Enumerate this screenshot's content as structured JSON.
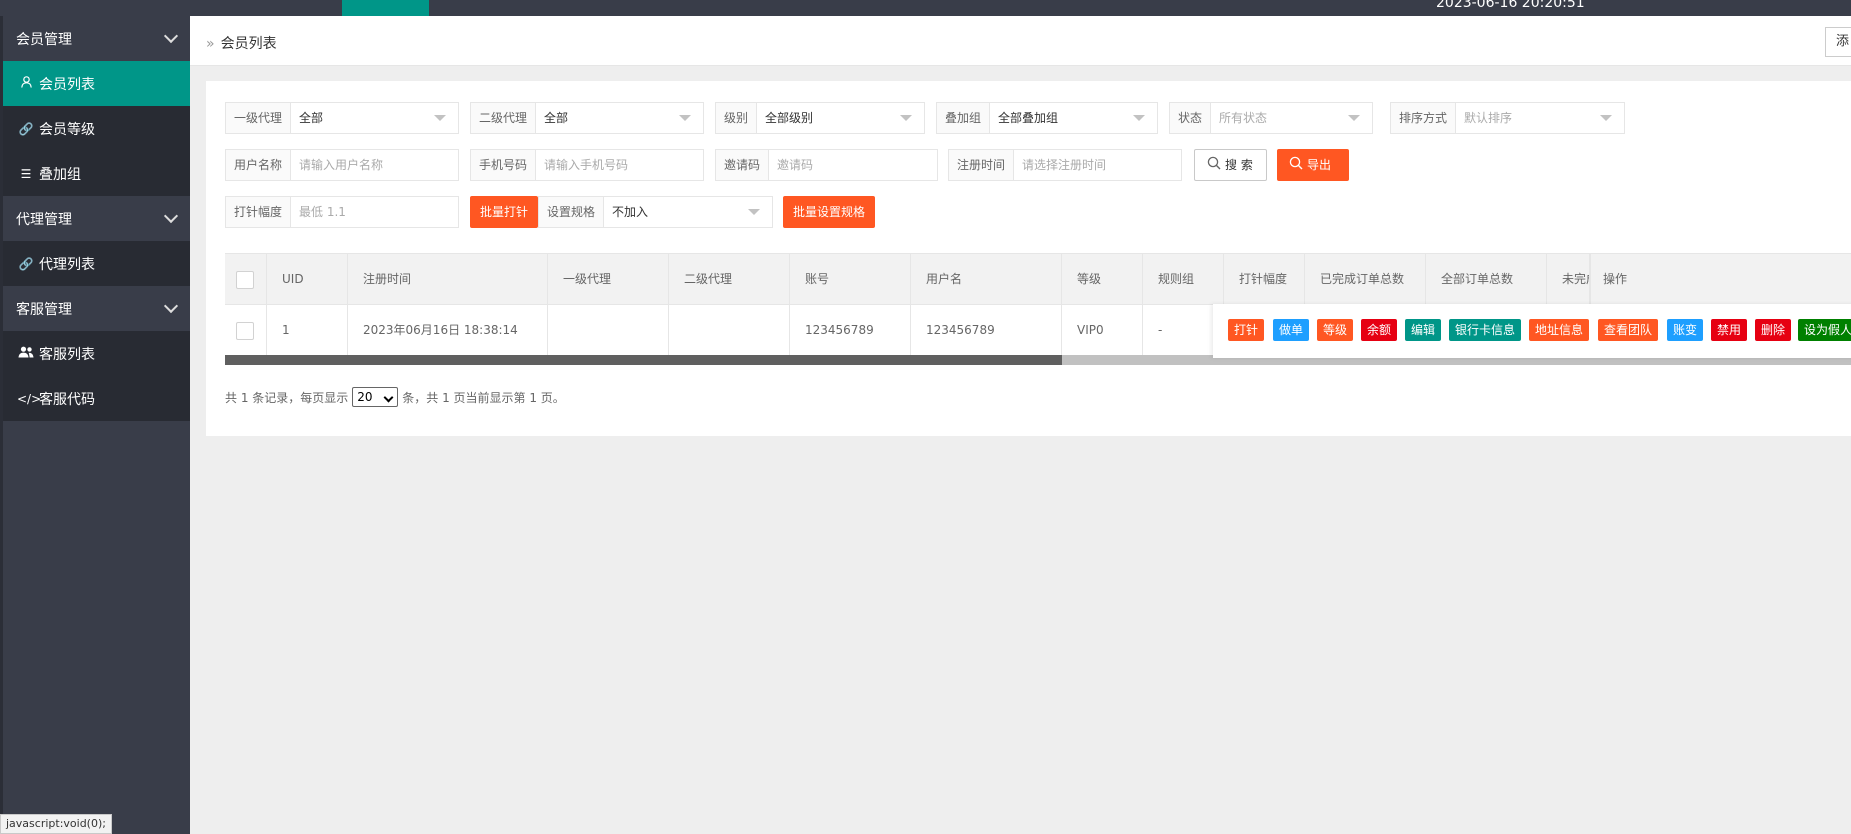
{
  "topbar": {
    "datetime": "2023-06-16 20:20:51"
  },
  "sidebar": {
    "groups": [
      {
        "title": "会员管理",
        "items": [
          {
            "label": "会员列表",
            "icon": "user-icon",
            "active": true
          },
          {
            "label": "会员等级",
            "icon": "link-icon"
          },
          {
            "label": "叠加组",
            "icon": "list-icon"
          }
        ]
      },
      {
        "title": "代理管理",
        "items": [
          {
            "label": "代理列表",
            "icon": "link-icon"
          }
        ]
      },
      {
        "title": "客服管理",
        "items": [
          {
            "label": "客服列表",
            "icon": "users-icon"
          },
          {
            "label": "客服代码",
            "icon": "code-icon"
          }
        ]
      }
    ]
  },
  "breadcrumb": {
    "current": "会员列表",
    "right_button": "添"
  },
  "filters": {
    "agent1": {
      "label": "一级代理",
      "value": "全部"
    },
    "agent2": {
      "label": "二级代理",
      "value": "全部"
    },
    "level": {
      "label": "级别",
      "value": "全部级别"
    },
    "group": {
      "label": "叠加组",
      "value": "全部叠加组"
    },
    "status": {
      "label": "状态",
      "placeholder": "所有状态"
    },
    "sort": {
      "label": "排序方式",
      "placeholder": "默认排序"
    },
    "username": {
      "label": "用户名称",
      "placeholder": "请输入用户名称"
    },
    "phone": {
      "label": "手机号码",
      "placeholder": "请输入手机号码"
    },
    "invite": {
      "label": "邀请码",
      "placeholder": "邀请码"
    },
    "regtime": {
      "label": "注册时间",
      "placeholder": "请选择注册时间"
    },
    "search_label": "搜 索",
    "export_label": "导出",
    "pin": {
      "label": "打针幅度",
      "placeholder": "最低 1.1"
    },
    "batch_pin_label": "批量打针",
    "rule": {
      "label": "设置规格",
      "value": "不加入"
    },
    "batch_rule_label": "批量设置规格"
  },
  "table": {
    "headers": [
      "UID",
      "注册时间",
      "一级代理",
      "二级代理",
      "账号",
      "用户名",
      "等级",
      "规则组",
      "打针幅度",
      "已完成订单总数",
      "全部订单总数",
      "未完成",
      "操作"
    ],
    "rows": [
      {
        "uid": "1",
        "regtime": "2023年06月16日 18:38:14",
        "agent1": "",
        "agent2": "",
        "account": "123456789",
        "username": "123456789",
        "level": "VIP0",
        "rule": "-"
      }
    ],
    "actions": [
      {
        "label": "打针",
        "color": "#ff5722"
      },
      {
        "label": "做单",
        "color": "#1e9fff"
      },
      {
        "label": "等级",
        "color": "#ff5722"
      },
      {
        "label": "余额",
        "color": "#e60012"
      },
      {
        "label": "编辑",
        "color": "#009688"
      },
      {
        "label": "银行卡信息",
        "color": "#009688"
      },
      {
        "label": "地址信息",
        "color": "#ff5722"
      },
      {
        "label": "查看团队",
        "color": "#ff5722"
      },
      {
        "label": "账变",
        "color": "#1e9fff"
      },
      {
        "label": "禁用",
        "color": "#e60012"
      },
      {
        "label": "删除",
        "color": "#e60012"
      },
      {
        "label": "设为假人",
        "color": "#008000"
      }
    ]
  },
  "pager": {
    "prefix": "共 1 条记录，每页显示",
    "page_size": "20",
    "suffix": "条，共 1 页当前显示第 1 页。"
  },
  "statusbar": "javascript:void(0);"
}
